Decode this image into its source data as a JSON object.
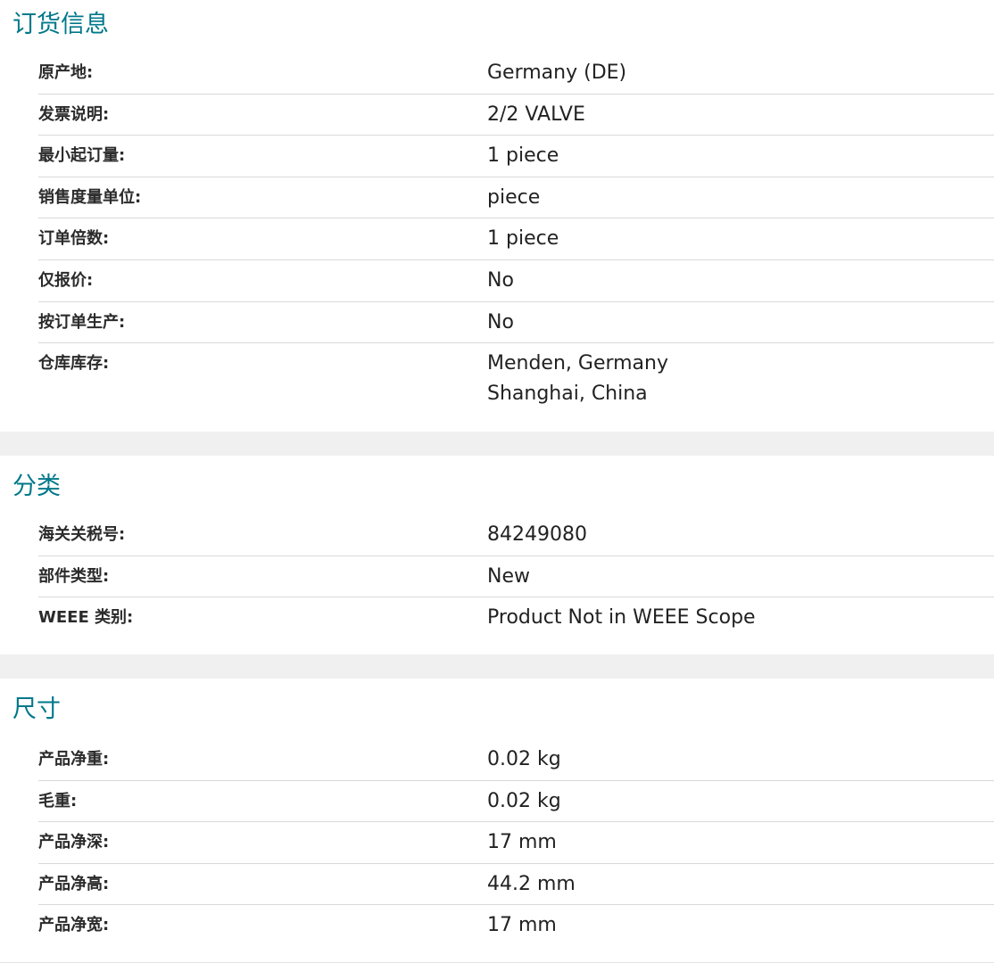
{
  "order_info": {
    "title": "订货信息",
    "rows": [
      {
        "label": "原产地:",
        "value": "Germany (DE)"
      },
      {
        "label": "发票说明:",
        "value": "2/2 VALVE"
      },
      {
        "label": "最小起订量:",
        "value": "1 piece"
      },
      {
        "label": "销售度量单位:",
        "value": "piece"
      },
      {
        "label": "订单倍数:",
        "value": "1 piece"
      },
      {
        "label": "仅报价:",
        "value": "No"
      },
      {
        "label": "按订单生产:",
        "value": "No"
      },
      {
        "label": "仓库库存:",
        "values": [
          "Menden, Germany",
          "Shanghai, China"
        ]
      }
    ]
  },
  "classification": {
    "title": "分类",
    "rows": [
      {
        "label": "海关关税号:",
        "value": "84249080"
      },
      {
        "label": "部件类型:",
        "value": "New"
      },
      {
        "label": "WEEE 类别:",
        "value": "Product Not in WEEE Scope"
      }
    ]
  },
  "dimensions": {
    "title": "尺寸",
    "rows": [
      {
        "label": "产品净重:",
        "value": "0.02 kg"
      },
      {
        "label": "毛重:",
        "value": "0.02 kg"
      },
      {
        "label": "产品净深:",
        "value": "17 mm"
      },
      {
        "label": "产品净高:",
        "value": "44.2 mm"
      },
      {
        "label": "产品净宽:",
        "value": "17 mm"
      }
    ]
  }
}
